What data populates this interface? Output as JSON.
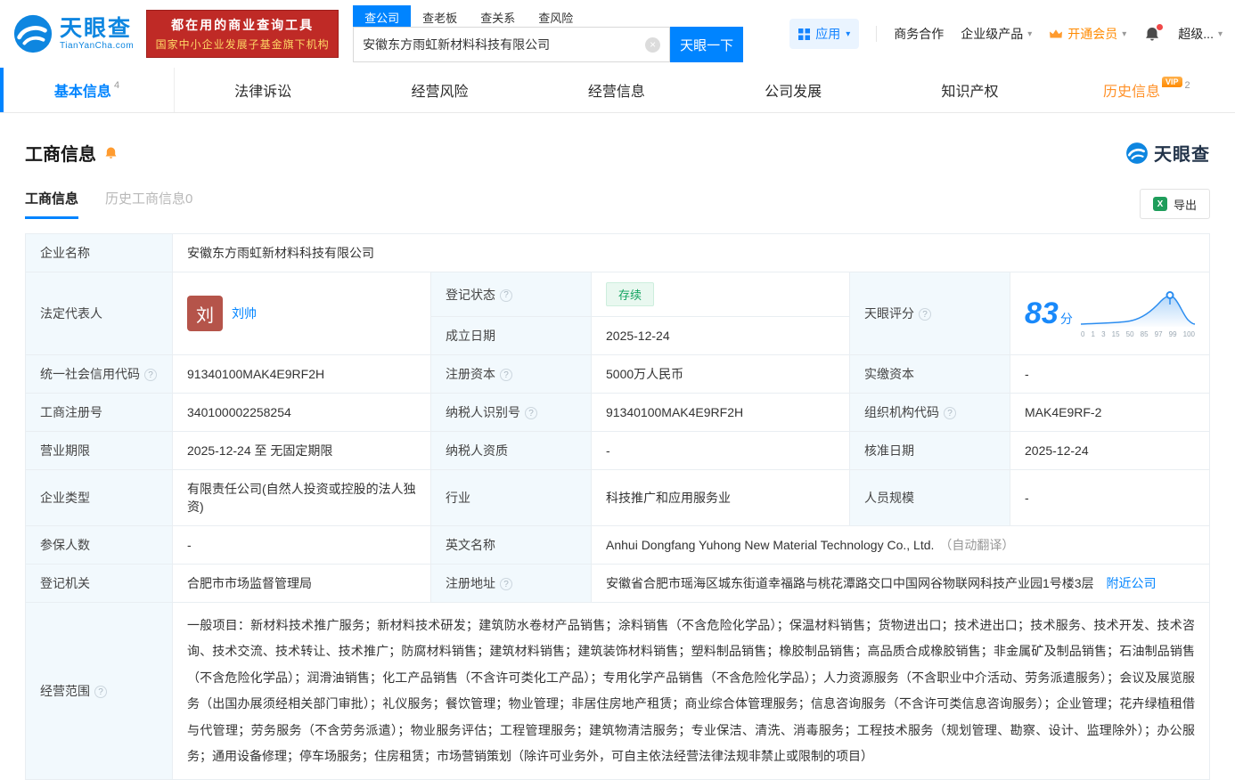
{
  "colors": {
    "brand_blue": "#0084ff",
    "vip_orange": "#ff8a00",
    "status_green": "#12a35f",
    "banner_red": "#bf2a26"
  },
  "header": {
    "logo": {
      "name": "天眼查",
      "domain": "TianYanCha.com"
    },
    "banner": {
      "line1": "都在用的商业查询工具",
      "line2": "国家中小企业发展子基金旗下机构"
    },
    "search_tabs": [
      {
        "label": "查公司"
      },
      {
        "label": "查老板"
      },
      {
        "label": "查关系"
      },
      {
        "label": "查风险"
      }
    ],
    "search": {
      "value": "安徽东方雨虹新材料科技有限公司",
      "button_label": "天眼一下"
    },
    "nav": {
      "apps": "应用",
      "cooperation": "商务合作",
      "enterprise": "企业级产品",
      "membership": "开通会员",
      "user": "超级..."
    }
  },
  "tabs": [
    {
      "label": "基本信息",
      "count": "4"
    },
    {
      "label": "法律诉讼"
    },
    {
      "label": "经营风险"
    },
    {
      "label": "经营信息"
    },
    {
      "label": "公司发展"
    },
    {
      "label": "知识产权"
    },
    {
      "label": "历史信息",
      "count": "2",
      "vip_badge": "VIP"
    }
  ],
  "section": {
    "title": "工商信息",
    "watermark": "天眼查",
    "sub_tabs": [
      {
        "label": "工商信息"
      },
      {
        "label": "历史工商信息0"
      }
    ],
    "export_label": "导出"
  },
  "table": {
    "company_name": {
      "label": "企业名称",
      "value": "安徽东方雨虹新材料科技有限公司"
    },
    "legal_rep": {
      "label": "法定代表人",
      "avatar": "刘",
      "name": "刘帅"
    },
    "reg_status": {
      "label": "登记状态",
      "value": "存续"
    },
    "establish_date": {
      "label": "成立日期",
      "value": "2025-12-24"
    },
    "tyc_score": {
      "label": "天眼评分",
      "score": "83",
      "unit": "分",
      "axis": [
        "0",
        "1",
        "3",
        "15",
        "50",
        "85",
        "97",
        "99",
        "100"
      ]
    },
    "credit_code": {
      "label": "统一社会信用代码",
      "value": "91340100MAK4E9RF2H"
    },
    "reg_capital": {
      "label": "注册资本",
      "value": "5000万人民币"
    },
    "paid_capital": {
      "label": "实缴资本",
      "value": "-"
    },
    "reg_number": {
      "label": "工商注册号",
      "value": "340100002258254"
    },
    "taxpayer_id": {
      "label": "纳税人识别号",
      "value": "91340100MAK4E9RF2H"
    },
    "org_code": {
      "label": "组织机构代码",
      "value": "MAK4E9RF-2"
    },
    "business_term": {
      "label": "营业期限",
      "value": "2025-12-24 至 无固定期限"
    },
    "taxpayer_quality": {
      "label": "纳税人资质",
      "value": "-"
    },
    "approval_date": {
      "label": "核准日期",
      "value": "2025-12-24"
    },
    "company_type": {
      "label": "企业类型",
      "value": "有限责任公司(自然人投资或控股的法人独资)"
    },
    "industry": {
      "label": "行业",
      "value": "科技推广和应用服务业"
    },
    "staff_size": {
      "label": "人员规模",
      "value": "-"
    },
    "insured_count": {
      "label": "参保人数",
      "value": "-"
    },
    "english_name": {
      "label": "英文名称",
      "value": "Anhui Dongfang Yuhong New Material Technology Co., Ltd.",
      "note": "（自动翻译）"
    },
    "reg_authority": {
      "label": "登记机关",
      "value": "合肥市市场监督管理局"
    },
    "reg_address": {
      "label": "注册地址",
      "value": "安徽省合肥市瑶海区城东街道幸福路与桃花潭路交口中国网谷物联网科技产业园1号楼3层",
      "link": "附近公司"
    },
    "business_scope": {
      "label": "经营范围",
      "value": "一般项目：新材料技术推广服务；新材料技术研发；建筑防水卷材产品销售；涂料销售（不含危险化学品）；保温材料销售；货物进出口；技术进出口；技术服务、技术开发、技术咨询、技术交流、技术转让、技术推广；防腐材料销售；建筑材料销售；建筑装饰材料销售；塑料制品销售；橡胶制品销售；高品质合成橡胶销售；非金属矿及制品销售；石油制品销售（不含危险化学品）；润滑油销售；化工产品销售（不含许可类化工产品）；专用化学产品销售（不含危险化学品）；人力资源服务（不含职业中介活动、劳务派遣服务）；会议及展览服务（出国办展须经相关部门审批）；礼仪服务；餐饮管理；物业管理；非居住房地产租赁；商业综合体管理服务；信息咨询服务（不含许可类信息咨询服务）；企业管理；花卉绿植租借与代管理；劳务服务（不含劳务派遣）；物业服务评估；工程管理服务；建筑物清洁服务；专业保洁、清洗、消毒服务；工程技术服务（规划管理、勘察、设计、监理除外）；办公服务；通用设备修理；停车场服务；住房租赁；市场营销策划（除许可业务外，可自主依法经营法律法规非禁止或限制的项目）"
    }
  }
}
